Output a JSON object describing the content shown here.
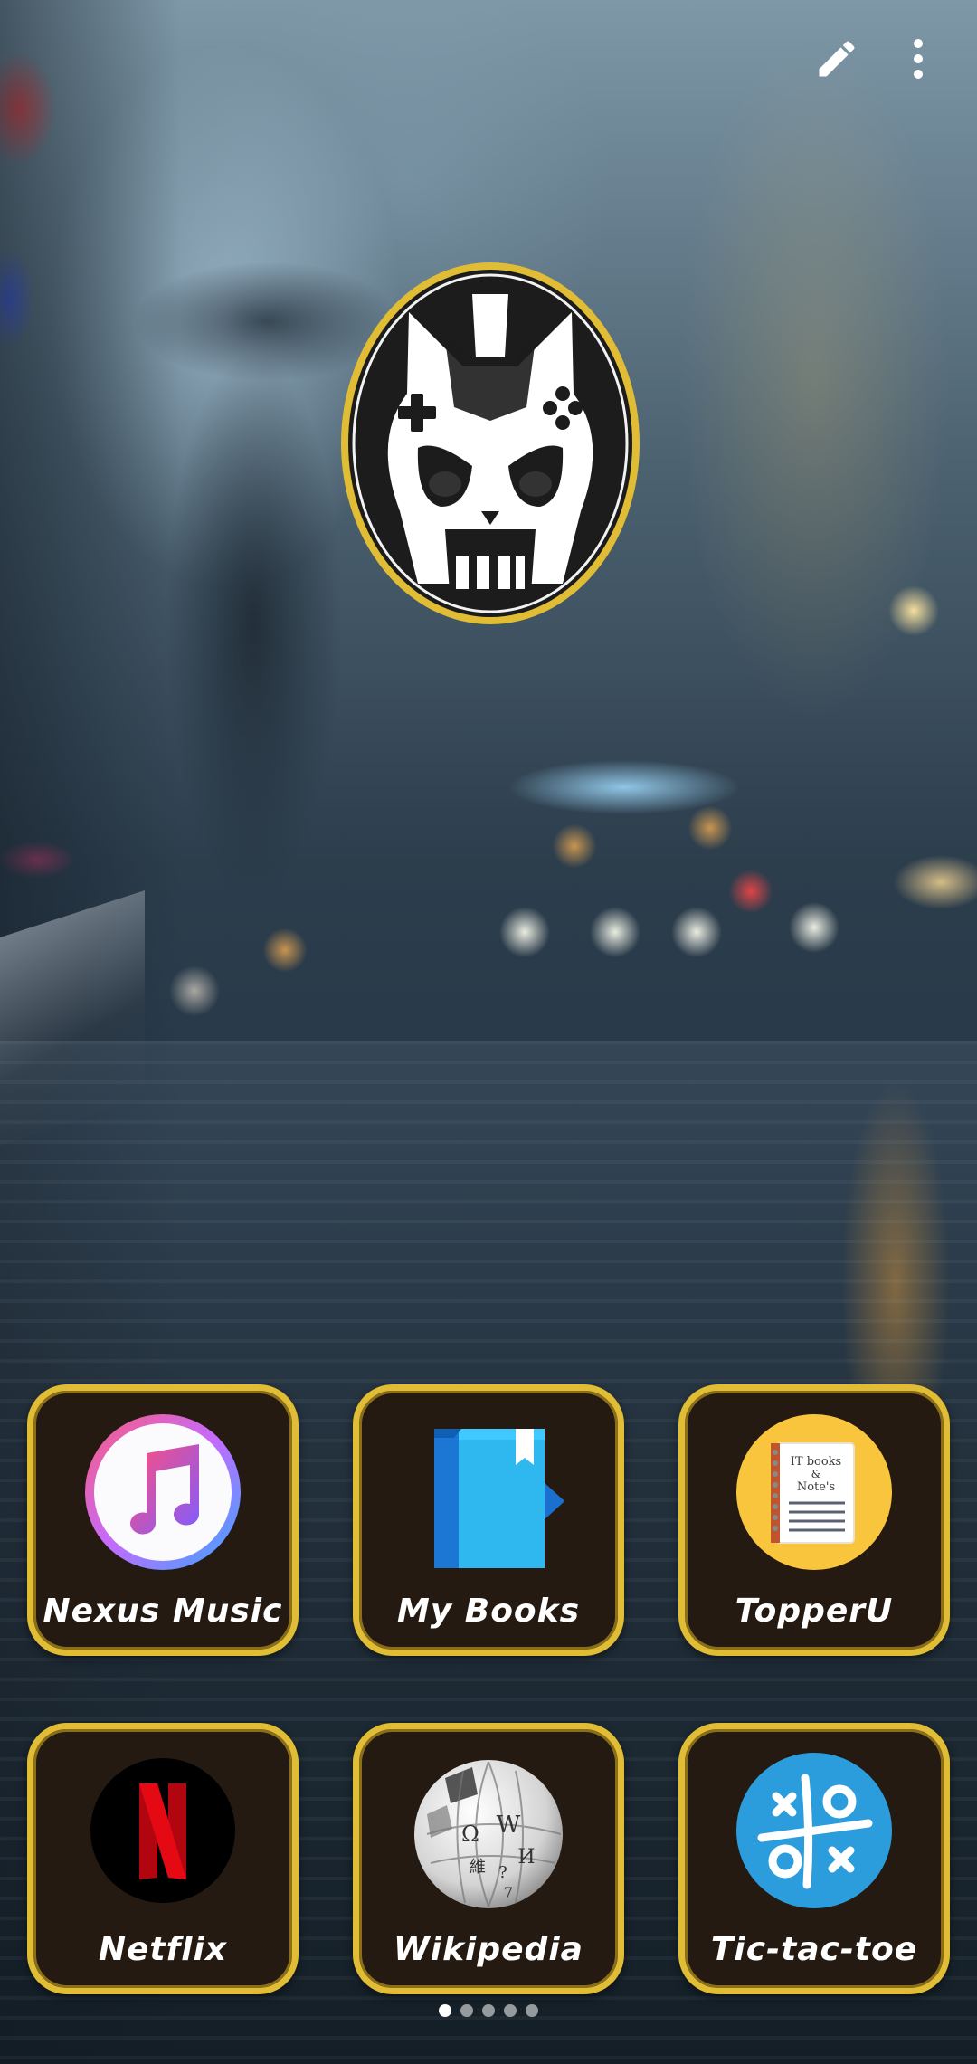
{
  "toolbar": {
    "edit_icon": "pencil-icon",
    "more_icon": "more-vertical-icon"
  },
  "logo": {
    "icon": "gaming-skull-logo",
    "ring_color": "#e0bd34"
  },
  "apps": [
    {
      "label": "Nexus Music",
      "icon": "music-note-icon"
    },
    {
      "label": "My Books",
      "icon": "play-books-icon"
    },
    {
      "label": "TopperU",
      "icon": "notebook-icon",
      "icon_text": "IT books & Note's"
    },
    {
      "label": "Netflix",
      "icon": "netflix-icon",
      "icon_text": "N"
    },
    {
      "label": "Wikipedia",
      "icon": "wikipedia-globe-icon"
    },
    {
      "label": "Tic-tac-toe",
      "icon": "tic-tac-toe-icon"
    }
  ],
  "pager": {
    "pages": 5,
    "current": 1
  },
  "colors": {
    "tile_border": "#e0bd34",
    "tile_background": "#241a12",
    "label": "#ffffff"
  }
}
